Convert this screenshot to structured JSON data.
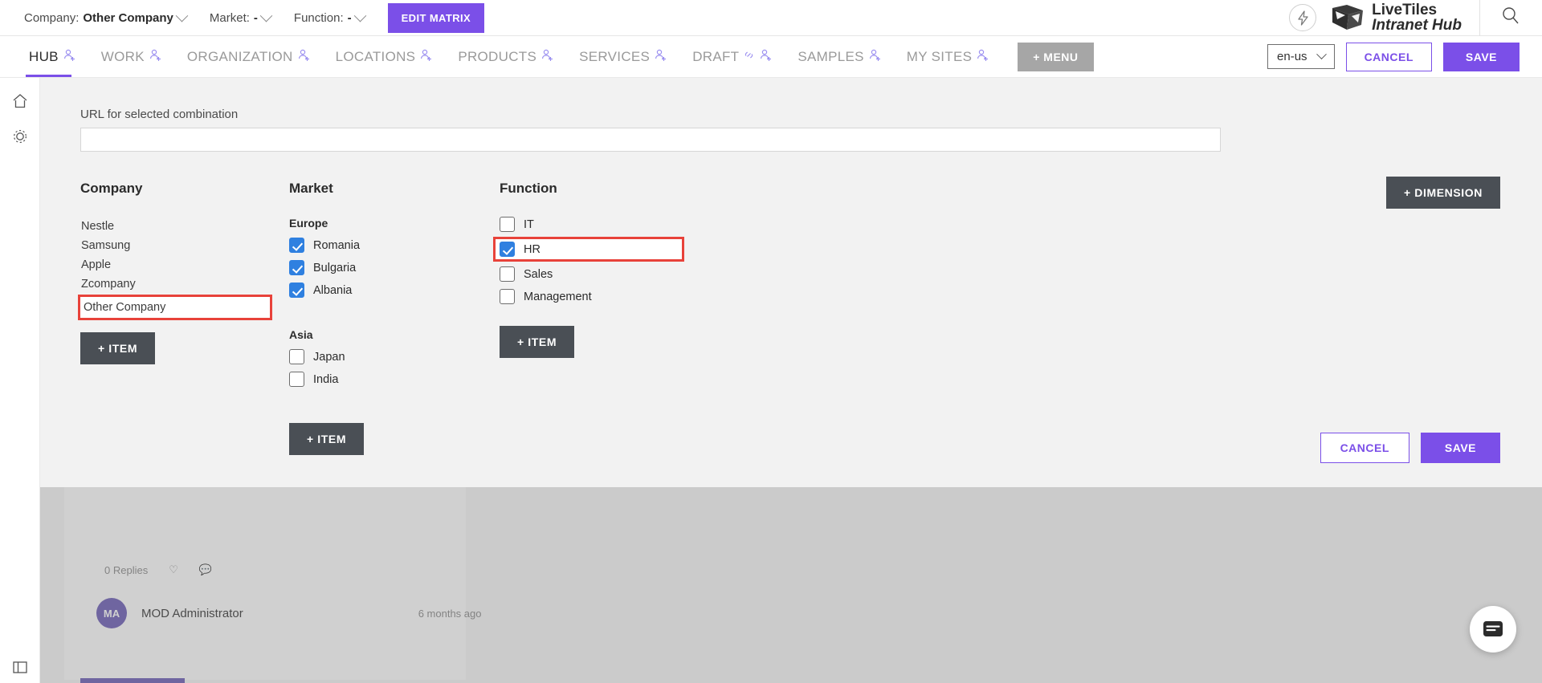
{
  "topbar": {
    "context": [
      {
        "label": "Company:",
        "value": "Other Company",
        "icon": "chevron-down-icon"
      },
      {
        "label": "Market:",
        "value": "-",
        "icon": "chevron-down-icon"
      },
      {
        "label": "Function:",
        "value": "-",
        "icon": "chevron-down-icon"
      }
    ],
    "edit_matrix_label": "EDIT MATRIX",
    "bolt_icon": "lightning-bolt-icon",
    "logo_line1": "LiveTiles",
    "logo_line2": "Intranet Hub",
    "search_icon": "search-icon"
  },
  "nav": {
    "items": [
      {
        "label": "HUB",
        "active": true,
        "icon": "add-person-icon"
      },
      {
        "label": "WORK",
        "active": false,
        "icon": "add-person-icon"
      },
      {
        "label": "ORGANIZATION",
        "active": false,
        "icon": "add-person-icon"
      },
      {
        "label": "LOCATIONS",
        "active": false,
        "icon": "add-person-icon"
      },
      {
        "label": "PRODUCTS",
        "active": false,
        "icon": "add-person-icon"
      },
      {
        "label": "SERVICES",
        "active": false,
        "icon": "add-person-icon"
      },
      {
        "label": "DRAFT",
        "active": false,
        "icon": "link-and-add-person-icon"
      },
      {
        "label": "SAMPLES",
        "active": false,
        "icon": "add-person-icon"
      },
      {
        "label": "MY SITES",
        "active": false,
        "icon": "add-person-icon"
      }
    ],
    "menu_button": "+ MENU",
    "language": "en-us",
    "cancel_label": "CANCEL",
    "save_label": "SAVE"
  },
  "rail": {
    "home_icon": "home-icon",
    "settings_icon": "gear-icon",
    "panel_icon": "panel-layout-icon"
  },
  "modal": {
    "url_label": "URL for selected combination",
    "url_value": "",
    "url_placeholder": "",
    "add_dimension_label": "+ DIMENSION",
    "cancel_label": "CANCEL",
    "save_label": "SAVE",
    "columns": [
      {
        "title": "Company",
        "type": "list",
        "items": [
          {
            "label": "Nestle",
            "highlighted": false
          },
          {
            "label": "Samsung",
            "highlighted": false
          },
          {
            "label": "Apple",
            "highlighted": false
          },
          {
            "label": "Zcompany",
            "highlighted": false
          },
          {
            "label": "Other Company",
            "highlighted": true
          }
        ],
        "add_item_label": "+ ITEM"
      },
      {
        "title": "Market",
        "type": "grouped-checkbox",
        "groups": [
          {
            "name": "Europe",
            "items": [
              {
                "label": "Romania",
                "checked": true,
                "highlighted": false
              },
              {
                "label": "Bulgaria",
                "checked": true,
                "highlighted": false
              },
              {
                "label": "Albania",
                "checked": true,
                "highlighted": false
              }
            ]
          },
          {
            "name": "Asia",
            "items": [
              {
                "label": "Japan",
                "checked": false,
                "highlighted": false
              },
              {
                "label": "India",
                "checked": false,
                "highlighted": false
              }
            ]
          }
        ],
        "add_item_label": "+ ITEM"
      },
      {
        "title": "Function",
        "type": "checkbox",
        "items": [
          {
            "label": "IT",
            "checked": false,
            "highlighted": false
          },
          {
            "label": "HR",
            "checked": true,
            "highlighted": true
          },
          {
            "label": "Sales",
            "checked": false,
            "highlighted": false
          },
          {
            "label": "Management",
            "checked": false,
            "highlighted": false
          }
        ],
        "add_item_label": "+ ITEM"
      }
    ]
  },
  "background": {
    "replies_text": "0 Replies",
    "author_initials": "MA",
    "author_name": "MOD Administrator",
    "timestamp": "6 months ago"
  },
  "chat": {
    "icon": "chat-bubble-icon"
  },
  "colors": {
    "accent_purple": "#7b4fe8",
    "checkbox_blue": "#2f80e0",
    "highlight_red": "#e8423a",
    "dark_button": "#4a4f55",
    "menu_gray": "#a6a6a6"
  }
}
